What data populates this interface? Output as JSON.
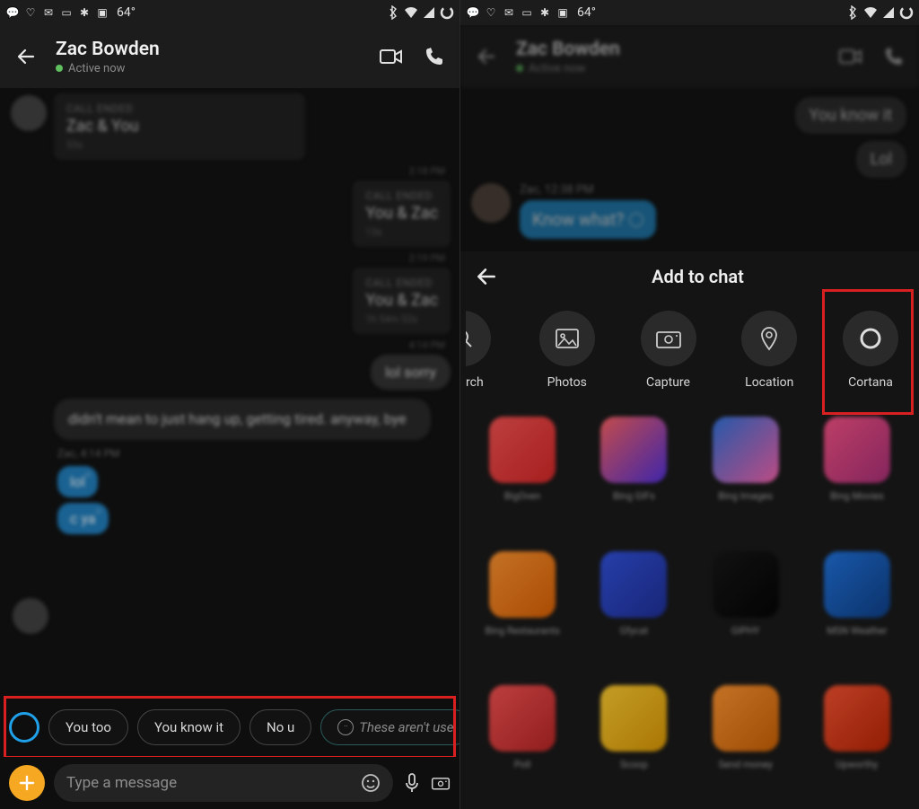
{
  "status": {
    "temperature": "64°"
  },
  "left": {
    "contact": {
      "name": "Zac Bowden",
      "presence": "Active now"
    },
    "calls": [
      {
        "label": "CALL ENDED",
        "party": "Zac & You",
        "sub": "53s"
      },
      {
        "label": "CALL ENDED",
        "party": "You & Zac",
        "sub": "13s",
        "ts": "2:18 PM"
      },
      {
        "label": "CALL ENDED",
        "party": "You & Zac",
        "sub": "1h 54m 52s",
        "ts": "2:19 PM"
      }
    ],
    "ts_out": "4:14 PM",
    "msg_out": "lol sorry",
    "msg_in": "didn't mean to just hang up, getting tired. anyway, bye",
    "meta_in": "Zac, 4:14 PM",
    "bubbles": [
      "lol",
      "c ya"
    ],
    "suggestions": [
      "You too",
      "You know it",
      "No u"
    ],
    "suggestion_dim": "These aren't use",
    "composer_placeholder": "Type a message"
  },
  "right": {
    "contact": {
      "name": "Zac Bowden",
      "presence": "Active now"
    },
    "out_msgs": [
      "You know it",
      "Lol"
    ],
    "zac_meta": "Zac, 12:38 PM",
    "zac_msg": "Know what?",
    "panel_title": "Add to chat",
    "categories": [
      {
        "key": "search",
        "label": "rch"
      },
      {
        "key": "photos",
        "label": "Photos"
      },
      {
        "key": "capture",
        "label": "Capture"
      },
      {
        "key": "location",
        "label": "Location"
      },
      {
        "key": "cortana",
        "label": "Cortana"
      }
    ],
    "apps": [
      {
        "name": "BigOven",
        "color1": "#e84a4a",
        "color2": "#c22"
      },
      {
        "name": "Bing GIFs",
        "color1": "#f05a5a",
        "color2": "#4a2ad0"
      },
      {
        "name": "Bing Images",
        "color1": "#2a6ad0",
        "color2": "#e85aa0"
      },
      {
        "name": "Bing Movies",
        "color1": "#e84a7a",
        "color2": "#a02a70"
      },
      {
        "name": "Bing Restaurants",
        "color1": "#f08a2a",
        "color2": "#d05a00"
      },
      {
        "name": "Gfycat",
        "color1": "#2a4ad0",
        "color2": "#1a2a90"
      },
      {
        "name": "GIPHY",
        "color1": "#111",
        "color2": "#000"
      },
      {
        "name": "MSN Weather",
        "color1": "#1a6ad0",
        "color2": "#0a3a80"
      },
      {
        "name": "Poll",
        "color1": "#e84a4a",
        "color2": "#b02020"
      },
      {
        "name": "Scoop",
        "color1": "#f0c02a",
        "color2": "#d09000"
      },
      {
        "name": "Send money",
        "color1": "#f08a2a",
        "color2": "#c05a00"
      },
      {
        "name": "Upworthy",
        "color1": "#e84a2a",
        "color2": "#b02000"
      }
    ]
  }
}
